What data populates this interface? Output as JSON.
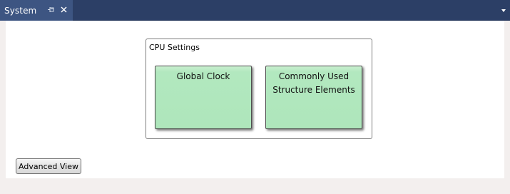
{
  "window": {
    "tab_title": "System",
    "pin_icon": "pin-icon",
    "close_icon": "close-icon",
    "menu_icon": "chevron-down-icon",
    "colors": {
      "tabstrip": "#2c3f66",
      "active_tab": "#3d5582",
      "block_fill": "#aee6bb"
    }
  },
  "group": {
    "title": "CPU Settings",
    "blocks": [
      {
        "label": "Global Clock"
      },
      {
        "label_line1": "Commonly Used",
        "label_line2": "Structure Elements"
      }
    ]
  },
  "footer": {
    "advanced_view_label": "Advanced View"
  }
}
